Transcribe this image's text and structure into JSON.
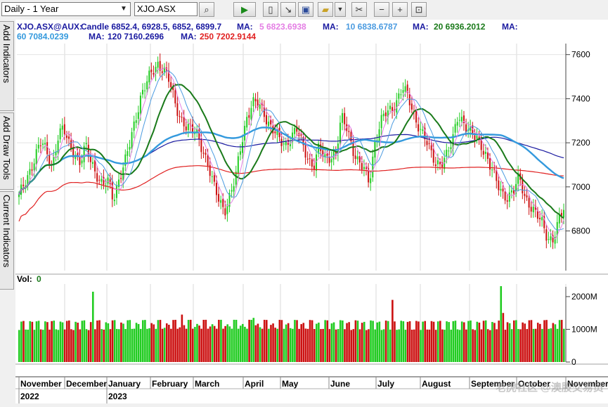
{
  "toolbar": {
    "period_select": "Daily - 1 Year",
    "symbol_input": "XJO.ASX",
    "icons": [
      "search-icon",
      "play-icon",
      "new-page-icon",
      "export-icon",
      "save-icon",
      "open-folder-icon",
      "dropdown-icon",
      "tools-icon",
      "zoom-out-icon",
      "zoom-in-icon",
      "fit-icon"
    ]
  },
  "side_tabs": [
    "Add Indicators",
    "Add Draw Tools",
    "Current Indicators"
  ],
  "legend": {
    "symbol": "XJO.ASX@AUX:",
    "candle": "Candle 6852.4, 6928.5, 6852, 6899.7",
    "ma_label": "MA:",
    "ma5": "5 6823.6938",
    "ma10": "10 6838.6787",
    "ma20": "20 6936.2012",
    "ma60": "60 7084.0239",
    "ma120": "120 7160.2696",
    "ma250": "250 7202.9144"
  },
  "volume_label": "Vol:",
  "volume_value": "0",
  "colors": {
    "ma5": "#e47ee4",
    "ma10": "#4b9be0",
    "ma20": "#1a7a1a",
    "ma60": "#3399dd",
    "ma120": "#1a1aa0",
    "ma250": "#e02020",
    "up": "#22cc22",
    "down": "#cc1111",
    "legend_blue": "#1a1aa0",
    "legend_red": "#e02020"
  },
  "watermark": "老虎社区 @澳股交易员",
  "chart_data": {
    "type": "candlestick",
    "price_axis": {
      "ticks": [
        6800,
        7000,
        7200,
        7400,
        7600
      ],
      "ylim": [
        6620,
        7650
      ]
    },
    "volume_axis": {
      "ticks": [
        "0",
        "1000M",
        "2000M"
      ],
      "ylim": [
        0,
        2300
      ]
    },
    "months": [
      "November",
      "December",
      "January",
      "February",
      "March",
      "April",
      "May",
      "June",
      "July",
      "August",
      "September",
      "October",
      "November"
    ],
    "years": [
      "2022",
      "2023"
    ],
    "series_close": [
      6950,
      7020,
      7080,
      7140,
      7200,
      7160,
      7100,
      7220,
      7260,
      7200,
      7160,
      7100,
      7180,
      7120,
      7060,
      7000,
      7020,
      6950,
      7040,
      7100,
      7200,
      7320,
      7420,
      7470,
      7520,
      7560,
      7540,
      7480,
      7380,
      7320,
      7280,
      7250,
      7240,
      7180,
      7100,
      7000,
      6940,
      6900,
      6960,
      7040,
      7200,
      7320,
      7380,
      7370,
      7340,
      7290,
      7250,
      7200,
      7190,
      7240,
      7260,
      7180,
      7130,
      7100,
      7180,
      7120,
      7140,
      7160,
      7310,
      7260,
      7180,
      7120,
      7080,
      7010,
      7200,
      7300,
      7330,
      7340,
      7400,
      7460,
      7400,
      7320,
      7280,
      7230,
      7150,
      7100,
      7120,
      7150,
      7200,
      7330,
      7300,
      7250,
      7220,
      7200,
      7150,
      7080,
      7010,
      6970,
      6960,
      6980,
      7040,
      6960,
      6920,
      6870,
      6840,
      6780,
      6760,
      6830,
      6900
    ],
    "ma5_final": 6823.6938,
    "ma10_final": 6838.6787,
    "ma20_final": 6936.2012,
    "ma60_final": 7084.0239,
    "ma120_final": 7160.2696,
    "ma250_final": 7202.9144
  }
}
